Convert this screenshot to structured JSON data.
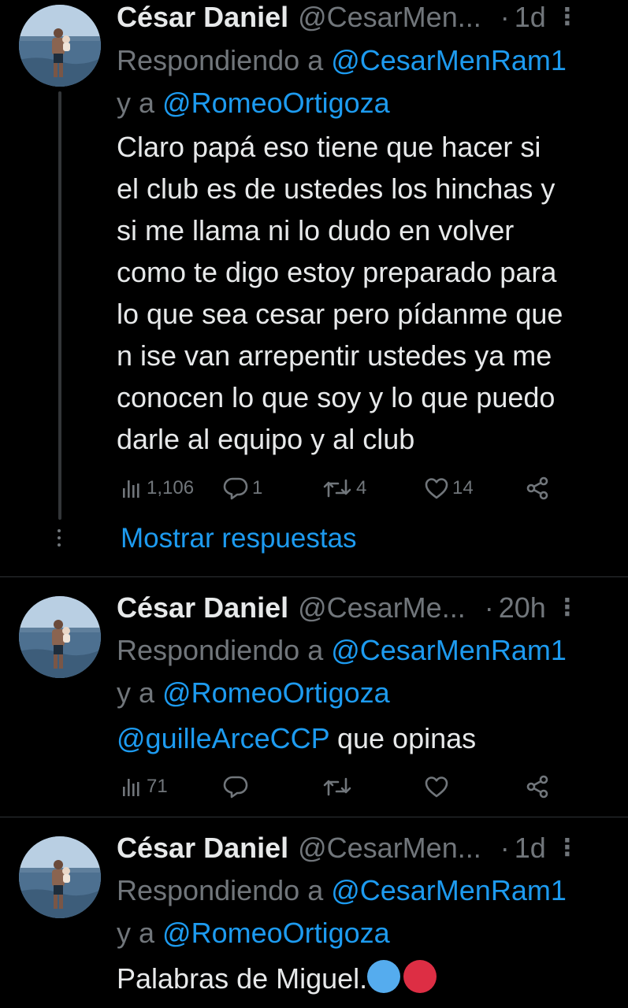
{
  "tweets": [
    {
      "name": "César Daniel",
      "handle": "@CesarMen...",
      "time": "1d",
      "more_label": "⋮",
      "replying_prefix": "Respondiendo a ",
      "replying_mention_1": "@CesarMenRam1",
      "replying_and": "y a ",
      "replying_mention_2": "@RomeoOrtigoza",
      "text_lines": [
        "Claro papá eso tiene que hacer si",
        "el club es de ustedes los hinchas y",
        "si me llama ni lo dudo en volver",
        "como te digo estoy preparado para",
        "lo que sea cesar pero pídanme que",
        "n ise van arrepentir ustedes ya me",
        "conocen lo que soy y lo que puedo",
        "darle al equipo y al club"
      ],
      "views": "1,106",
      "replies": "1",
      "retweets": "4",
      "likes": "14",
      "show_replies": "Mostrar respuestas"
    },
    {
      "name": "César Daniel",
      "handle": "@CesarMe...",
      "time": "20h",
      "more_label": "⋮",
      "replying_prefix": "Respondiendo a ",
      "replying_mention_1": "@CesarMenRam1",
      "replying_and": "y a ",
      "replying_mention_2": "@RomeoOrtigoza",
      "text_mention": "@guilleArceCCP",
      "text_rest": " que opinas",
      "views": "71"
    },
    {
      "name": "César Daniel",
      "handle": "@CesarMen...",
      "time": "1d",
      "more_label": "⋮",
      "replying_prefix": "Respondiendo a ",
      "replying_mention_1": "@CesarMenRam1",
      "replying_and": "y a ",
      "replying_mention_2": "@RomeoOrtigoza",
      "text": "Palabras de Miguel.",
      "emoji_colors": [
        "#55acee",
        "#dd2e44"
      ]
    }
  ],
  "colors": {
    "background": "#000000",
    "text": "#e7e9ea",
    "secondary": "#71767b",
    "accent": "#1d9bf0"
  }
}
